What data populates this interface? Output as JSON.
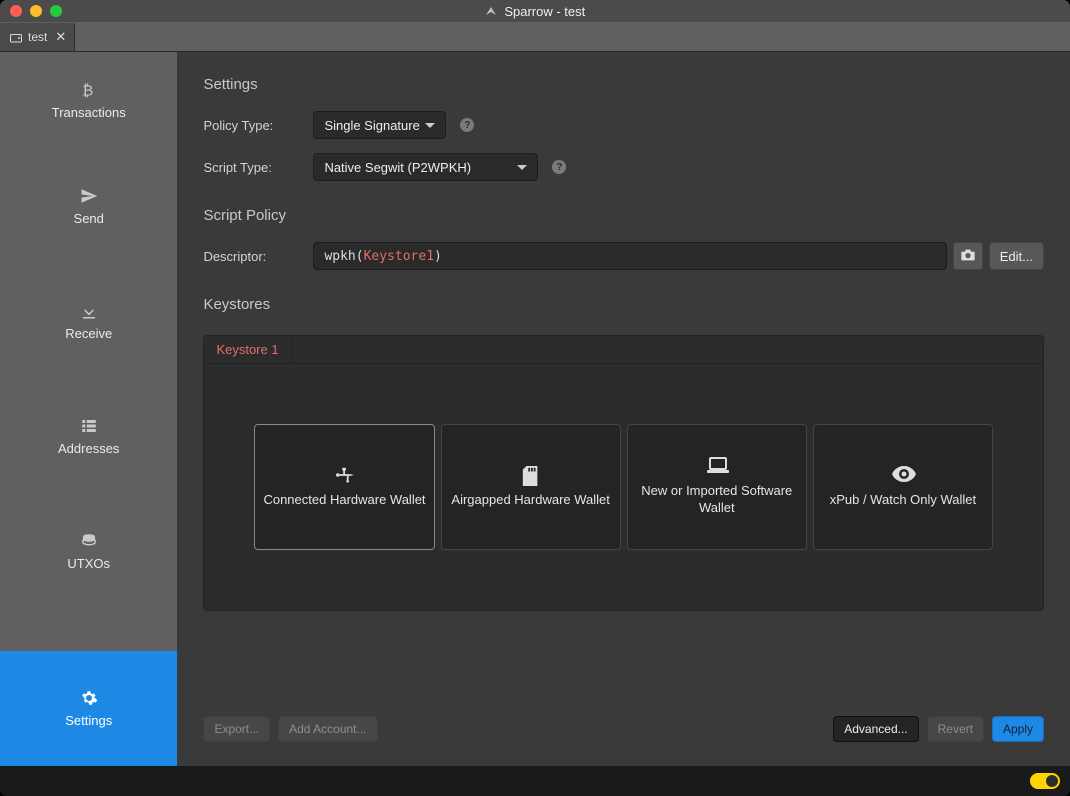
{
  "window": {
    "title": "Sparrow - test"
  },
  "tabs": [
    {
      "label": "test"
    }
  ],
  "sidebar": {
    "items": [
      {
        "label": "Transactions",
        "icon": "bitcoin-icon"
      },
      {
        "label": "Send",
        "icon": "send-plane-icon"
      },
      {
        "label": "Receive",
        "icon": "download-arrow-icon"
      },
      {
        "label": "Addresses",
        "icon": "list-icon"
      },
      {
        "label": "UTXOs",
        "icon": "coins-icon"
      },
      {
        "label": "Settings",
        "icon": "gear-icon"
      }
    ],
    "active_index": 5
  },
  "settings": {
    "heading": "Settings",
    "policy_type": {
      "label": "Policy Type:",
      "value": "Single Signature"
    },
    "script_type": {
      "label": "Script Type:",
      "value": "Native Segwit (P2WPKH)"
    }
  },
  "script_policy": {
    "heading": "Script Policy",
    "descriptor_label": "Descriptor:",
    "descriptor_prefix": "wpkh(",
    "descriptor_key": "Keystore1",
    "descriptor_suffix": ")",
    "edit_label": "Edit..."
  },
  "keystores": {
    "heading": "Keystores",
    "tabs": [
      {
        "label": "Keystore 1"
      }
    ],
    "cards": [
      {
        "label": "Connected Hardware Wallet",
        "icon": "usb-icon"
      },
      {
        "label": "Airgapped Hardware Wallet",
        "icon": "sd-card-icon"
      },
      {
        "label": "New or Imported Software Wallet",
        "icon": "laptop-icon"
      },
      {
        "label": "xPub / Watch Only Wallet",
        "icon": "eye-icon"
      }
    ],
    "selected_index": 0
  },
  "actions": {
    "export": "Export...",
    "add_account": "Add Account...",
    "advanced": "Advanced...",
    "revert": "Revert",
    "apply": "Apply"
  },
  "statusbar": {
    "toggle_on": true
  }
}
